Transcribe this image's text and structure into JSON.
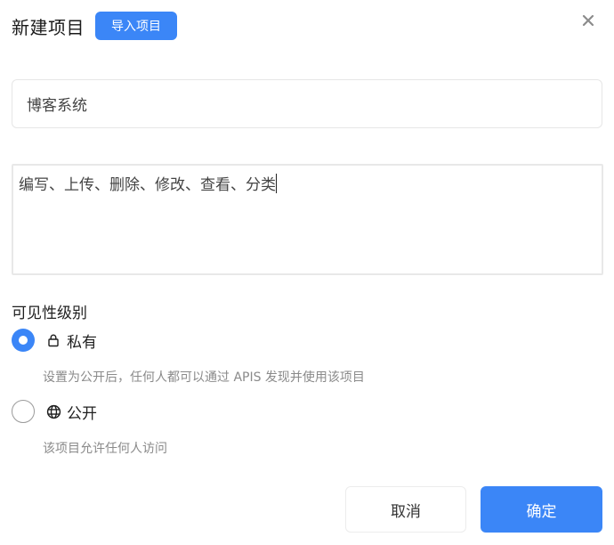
{
  "header": {
    "title": "新建项目",
    "import_label": "导入项目"
  },
  "form": {
    "name_value": "博客系统",
    "description_value": "编写、上传、删除、修改、查看、分类"
  },
  "visibility": {
    "label": "可见性级别",
    "options": [
      {
        "label": "私有",
        "description": "设置为公开后，任何人都可以通过 APIS 发现并使用该项目",
        "icon": "lock-icon",
        "selected": true
      },
      {
        "label": "公开",
        "description": "该项目允许任何人访问",
        "icon": "globe-icon",
        "selected": false
      }
    ]
  },
  "footer": {
    "cancel_label": "取消",
    "ok_label": "确定"
  },
  "colors": {
    "accent": "#3b86f7"
  }
}
